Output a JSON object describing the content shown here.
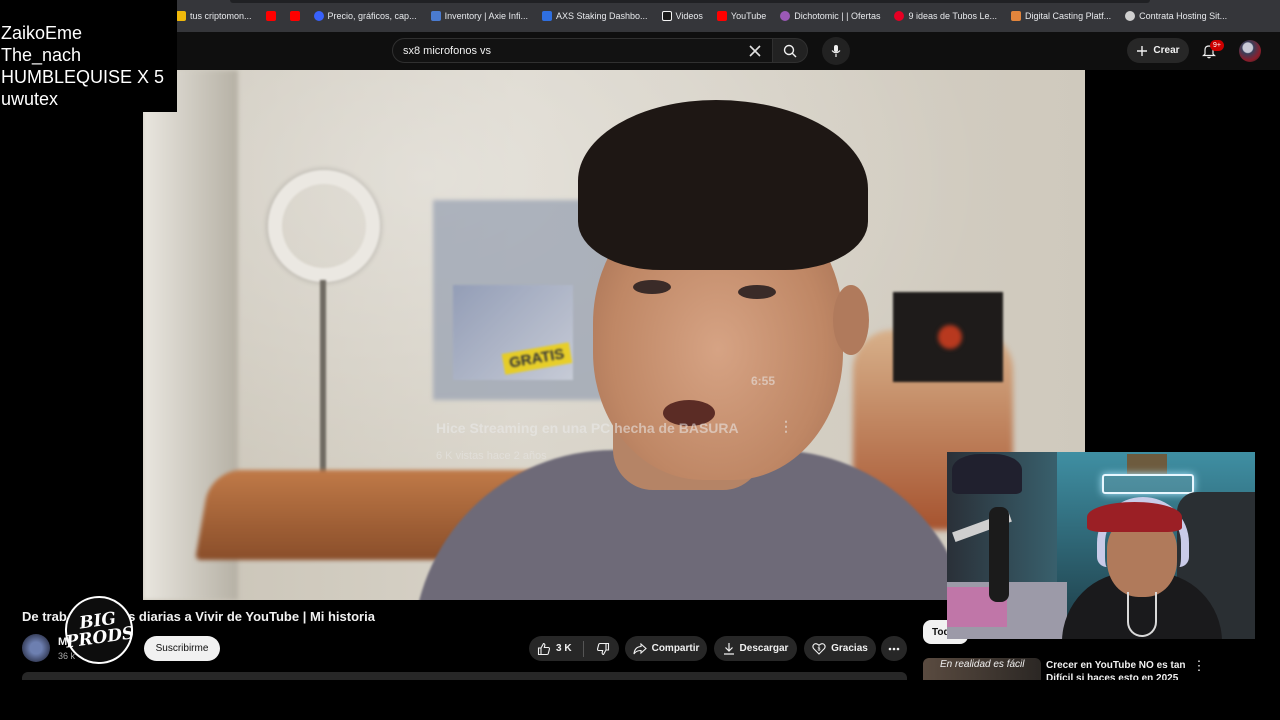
{
  "bookmarks": [
    {
      "label": "tus criptomon...",
      "color": "#f0b90b"
    },
    {
      "label": "",
      "color": "#ff0000"
    },
    {
      "label": "",
      "color": "#ff0000"
    },
    {
      "label": "Precio, gráficos, cap...",
      "color": "#3861fb"
    },
    {
      "label": "Inventory | Axie Infi...",
      "color": "#4a7bd0"
    },
    {
      "label": "AXS Staking Dashbo...",
      "color": "#2f6fe0"
    },
    {
      "label": "Videos",
      "color": "#f5f5f5"
    },
    {
      "label": "YouTube",
      "color": "#ff0000"
    },
    {
      "label": "Dichotomic | | Ofertas",
      "color": "#9b59b6"
    },
    {
      "label": "9 ideas de Tubos Le...",
      "color": "#e60023"
    },
    {
      "label": "Digital Casting Platf...",
      "color": "#e2853c"
    },
    {
      "label": "Contrata Hosting Sit...",
      "color": "#cfcfcf"
    }
  ],
  "header": {
    "search_query": "sx8 microfonos vs",
    "create_label": "Crear",
    "notifications_badge": "9+"
  },
  "overlay_names": [
    "ZaikoEme",
    "The_nach",
    "HUMBLEQUISE X 5",
    "uwutex"
  ],
  "video": {
    "overlay_title": "Hice Streaming en una PC hecha de BASURA",
    "overlay_meta": "6 K vistas  hace 2 años",
    "overlay_duration": "6:55",
    "sign_text": "GRATIS"
  },
  "watch": {
    "title_left": "De trab",
    "title_right": "ras diarias a Vivir de YouTube | Mi historia",
    "channel_name": "M",
    "channel_subs": "36 k",
    "logo_line1": "BIG",
    "logo_line2": "PRODS",
    "subscribe_label": "Suscribirme",
    "likes": "3 K",
    "share_label": "Compartir",
    "download_label": "Descargar",
    "thanks_label": "Gracias"
  },
  "sidebar": {
    "chip_label": "Tod",
    "rec_thumb_text": "En realidad es fácil",
    "rec_title": "Crecer en YouTube NO es tan Difícil si haces esto en 2025"
  }
}
